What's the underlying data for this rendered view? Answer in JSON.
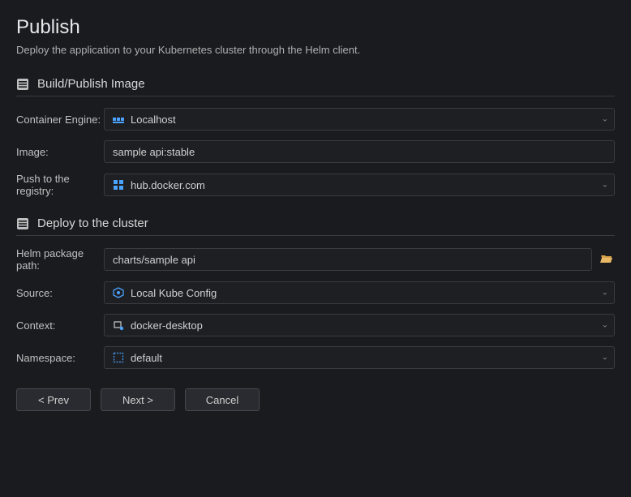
{
  "header": {
    "title": "Publish",
    "subtitle": "Deploy the application to your Kubernetes cluster through the Helm client."
  },
  "sections": {
    "build": {
      "title": "Build/Publish Image",
      "fields": {
        "engine": {
          "label": "Container Engine:",
          "value": "Localhost",
          "icon": "container-host-icon"
        },
        "image": {
          "label": "Image:",
          "value": "sample api:stable"
        },
        "push": {
          "label": "Push to the registry:",
          "value": "hub.docker.com",
          "icon": "registry-icon"
        }
      }
    },
    "deploy": {
      "title": "Deploy to the cluster",
      "fields": {
        "helm": {
          "label": "Helm package path:",
          "value": "charts/sample api"
        },
        "source": {
          "label": "Source:",
          "value": "Local Kube Config",
          "icon": "kube-config-icon"
        },
        "context": {
          "label": "Context:",
          "value": "docker-desktop",
          "icon": "context-icon"
        },
        "namespace": {
          "label": "Namespace:",
          "value": "default",
          "icon": "namespace-icon"
        }
      }
    }
  },
  "footer": {
    "prev": "< Prev",
    "next": "Next >",
    "cancel": "Cancel"
  },
  "colors": {
    "accent_blue": "#4aa3ff",
    "folder": "#d6a24a"
  }
}
